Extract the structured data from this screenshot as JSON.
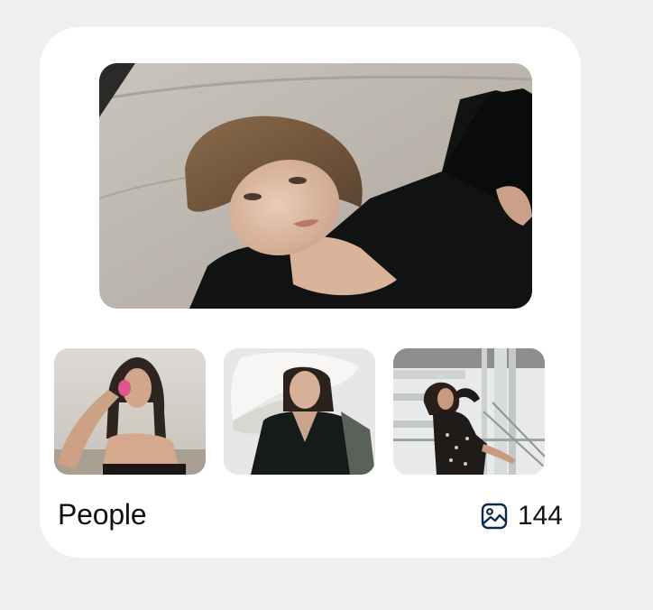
{
  "album": {
    "title": "People",
    "count": "144",
    "count_icon": "gallery-icon",
    "icon_color": "#0f2a4a"
  },
  "photos": {
    "hero": "portrait-woman-lying-on-sofa",
    "thumbnails": [
      "portrait-woman-holding-pink-flower",
      "portrait-woman-with-white-cloth",
      "portrait-woman-by-balcony-railing"
    ]
  }
}
